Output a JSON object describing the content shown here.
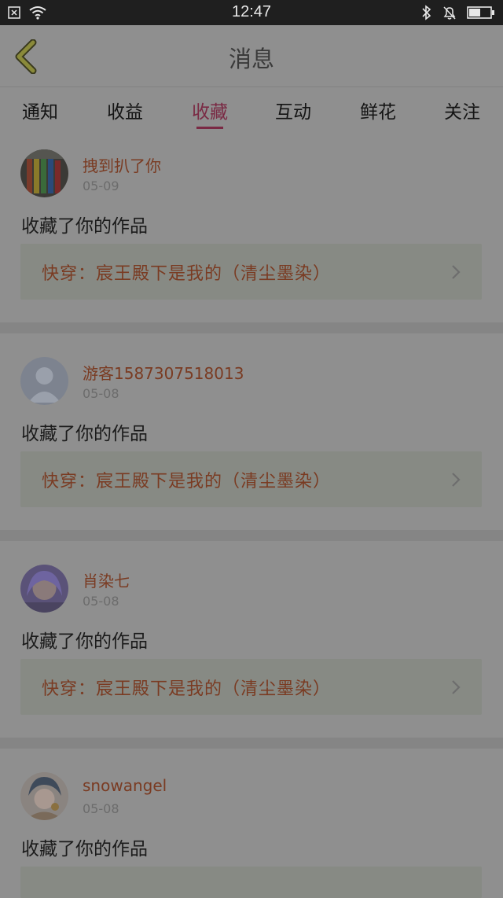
{
  "status_bar": {
    "time": "12:47"
  },
  "header": {
    "title": "消息"
  },
  "tabs": [
    {
      "label": "通知"
    },
    {
      "label": "收益"
    },
    {
      "label": "收藏",
      "active": true
    },
    {
      "label": "互动"
    },
    {
      "label": "鲜花"
    },
    {
      "label": "关注"
    }
  ],
  "feed": [
    {
      "username": "拽到扒了你",
      "date": "05-09",
      "message": "收藏了你的作品",
      "work_title": "快穿：宸王殿下是我的（清尘墨染）",
      "avatar": "pencils-avatar"
    },
    {
      "username": "游客1587307518013",
      "date": "05-08",
      "message": "收藏了你的作品",
      "work_title": "快穿：宸王殿下是我的（清尘墨染）",
      "avatar": "default-user-avatar"
    },
    {
      "username": "肖染七",
      "date": "05-08",
      "message": "收藏了你的作品",
      "work_title": "快穿：宸王殿下是我的（清尘墨染）",
      "avatar": "girl-photo-avatar"
    },
    {
      "username": "snowangel",
      "date": "05-08",
      "message": "收藏了你的作品",
      "work_title": "",
      "avatar": "anime-avatar"
    }
  ],
  "colors": {
    "accent": "#7a2a44",
    "link_text": "#7a3b22",
    "overlay_bg": "#8f8f8f"
  }
}
